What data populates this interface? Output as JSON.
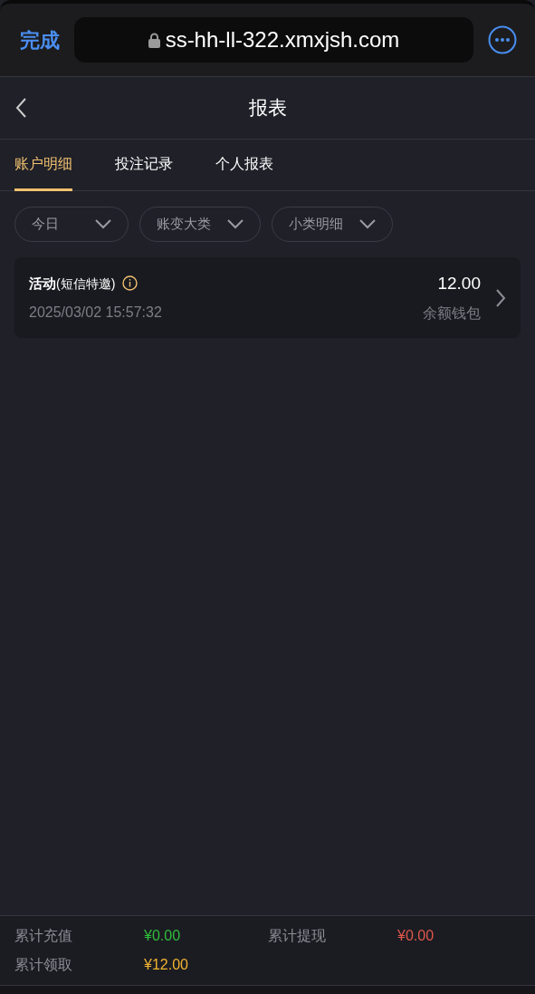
{
  "browser": {
    "done": "完成",
    "url": "ss-hh-ll-322.xmxjsh.com"
  },
  "header": {
    "title": "报表"
  },
  "tabs": [
    {
      "label": "账户明细",
      "selected": true
    },
    {
      "label": "投注记录",
      "selected": false
    },
    {
      "label": "个人报表",
      "selected": false
    }
  ],
  "filters": [
    {
      "label": "今日"
    },
    {
      "label": "账变大类"
    },
    {
      "label": "小类明细"
    }
  ],
  "records": [
    {
      "title": "活动",
      "tag": "(短信特邀)",
      "time": "2025/03/02 15:57:32",
      "amount": "12.00",
      "wallet": "余额钱包"
    }
  ],
  "summary": [
    {
      "label": "累计充值",
      "value": "¥0.00",
      "color": "#2fbf3a"
    },
    {
      "label": "累计提现",
      "value": "¥0.00",
      "color": "#e0574c"
    },
    {
      "label": "累计领取",
      "value": "¥12.00",
      "color": "#f2b431"
    }
  ]
}
